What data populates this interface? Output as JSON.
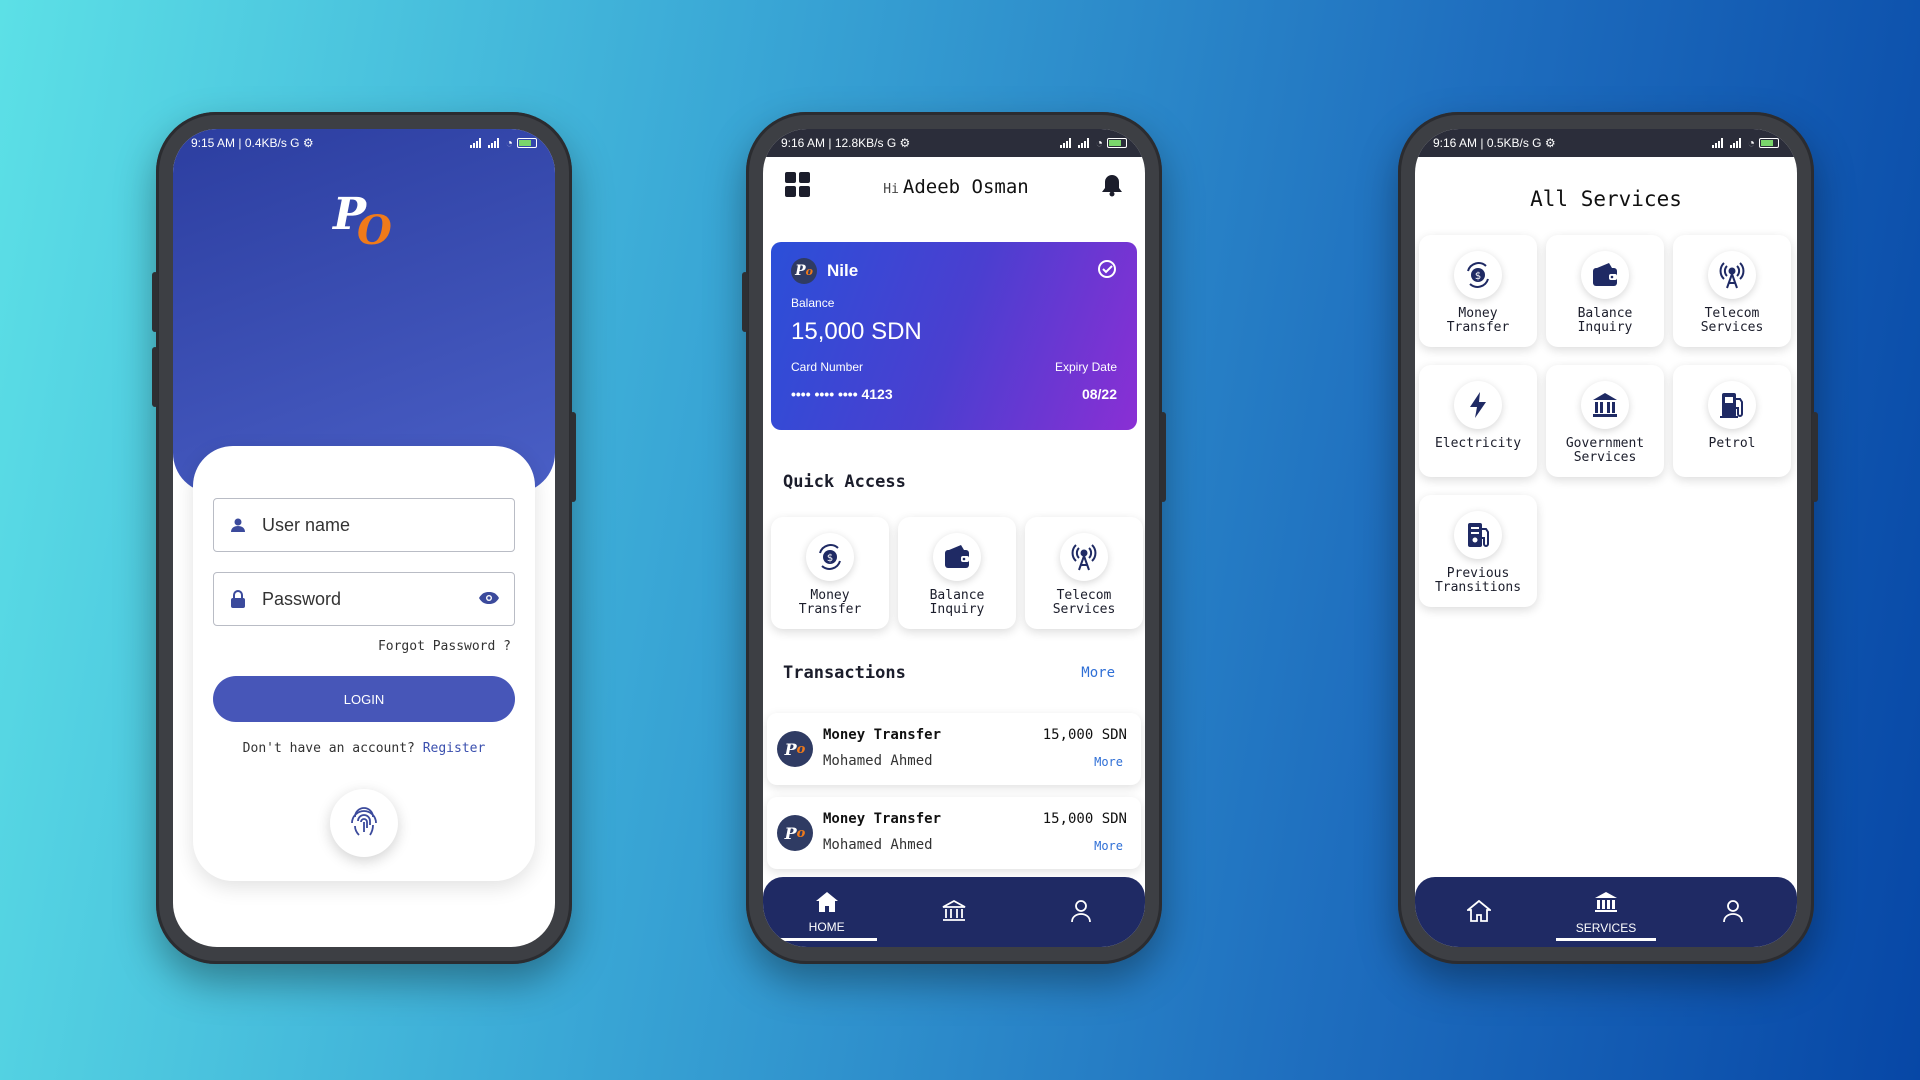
{
  "colors": {
    "accent": "#4756b8",
    "navy": "#1f2a64",
    "link": "#2f6fd6",
    "logo_orange": "#f07a1a"
  },
  "logo": {
    "letter_p": "P",
    "letter_o": "O"
  },
  "login_screen": {
    "status": {
      "left": "9:15 AM | 0.4KB/s G ⚙"
    },
    "username_placeholder": "User name",
    "password_placeholder": "Password",
    "forgot_password": "Forgot Password ?",
    "login_label": "LOGIN",
    "no_account_text": "Don't have an account?",
    "register_link": "Register",
    "icons": [
      "user-icon",
      "lock-icon",
      "eye-icon",
      "fingerprint-icon"
    ]
  },
  "home_screen": {
    "status": {
      "left": "9:16 AM | 12.8KB/s G ⚙"
    },
    "greeting_prefix": "Hi",
    "user_name": "Adeeb Osman",
    "card": {
      "bank_name": "Nile",
      "balance_label": "Balance",
      "balance_value": "15,000 SDN",
      "card_number_label": "Card Number",
      "card_number": "•••• •••• •••• 4123",
      "expiry_label": "Expiry Date",
      "expiry_value": "08/22"
    },
    "quick_access_title": "Quick Access",
    "quick_access": [
      {
        "line1": "Money",
        "line2": "Transfer",
        "icon": "money-transfer-icon"
      },
      {
        "line1": "Balance",
        "line2": "Inquiry",
        "icon": "wallet-icon"
      },
      {
        "line1": "Telecom",
        "line2": "Services",
        "icon": "antenna-icon"
      }
    ],
    "transactions_title": "Transactions",
    "transactions_more": "More",
    "transactions": [
      {
        "title": "Money Transfer",
        "name": "Mohamed Ahmed",
        "amount": "15,000 SDN",
        "more": "More"
      },
      {
        "title": "Money Transfer",
        "name": "Mohamed Ahmed",
        "amount": "15,000 SDN",
        "more": "More"
      }
    ],
    "nav": {
      "home": "HOME"
    }
  },
  "services_screen": {
    "status": {
      "left": "9:16 AM | 0.5KB/s G ⚙"
    },
    "title": "All Services",
    "services": [
      {
        "line1": "Money",
        "line2": "Transfer",
        "icon": "money-transfer-icon"
      },
      {
        "line1": "Balance",
        "line2": "Inquiry",
        "icon": "wallet-icon"
      },
      {
        "line1": "Telecom",
        "line2": "Services",
        "icon": "antenna-icon"
      },
      {
        "line1": "Electricity",
        "line2": "",
        "icon": "lightning-icon"
      },
      {
        "line1": "Government",
        "line2": "Services",
        "icon": "government-icon"
      },
      {
        "line1": "Petrol",
        "line2": "",
        "icon": "fuel-icon"
      },
      {
        "line1": "Previous",
        "line2": "Transitions",
        "icon": "receipt-icon"
      }
    ],
    "nav": {
      "services": "SERVICES"
    }
  }
}
